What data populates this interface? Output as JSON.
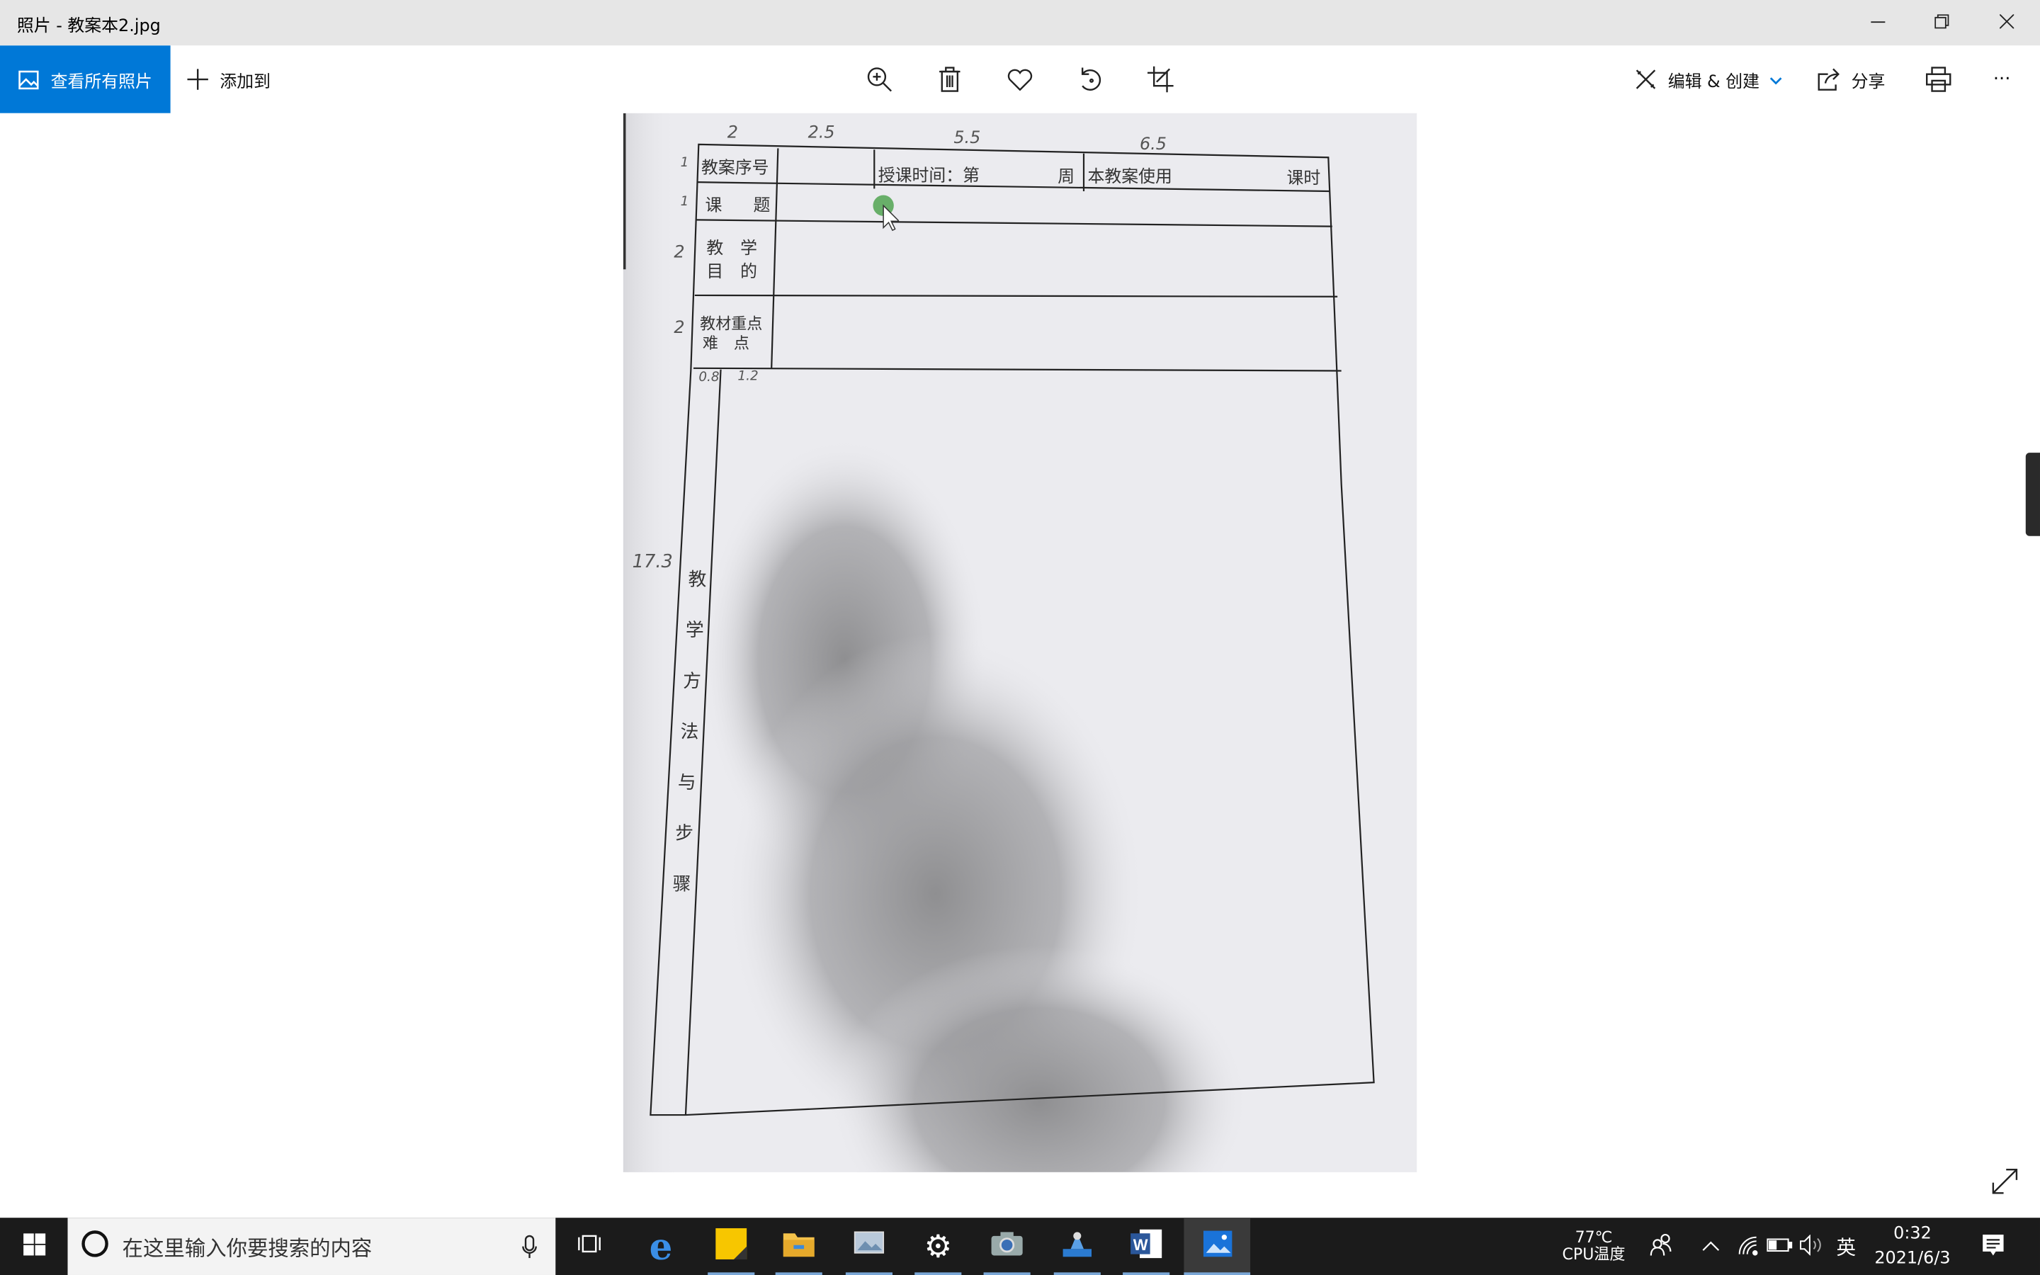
{
  "window": {
    "title": "照片 - 教案本2.jpg",
    "minimize_icon": "minimize-icon",
    "restore_icon": "restore-icon",
    "close_icon": "close-icon"
  },
  "toolbar": {
    "view_all": "查看所有照片",
    "add_to": "添加到",
    "center_icons": [
      "zoom-in-icon",
      "delete-icon",
      "heart-icon",
      "rotate-icon",
      "crop-icon"
    ],
    "edit_create": "编辑 & 创建",
    "share": "分享",
    "print_icon": "print-icon",
    "more": "···",
    "accent": "#0078d7"
  },
  "photo": {
    "file": "教案本2.jpg",
    "form": {
      "row1_label": "教案序号",
      "row1_time": "授课时间：第",
      "row1_week": "周",
      "row1_use": "本教案使用",
      "row1_hours": "课时",
      "row2_a": "课",
      "row2_b": "题",
      "row3_a": "教　学",
      "row3_b": "目　的",
      "row4_a": "教材重点",
      "row4_b": "难　点",
      "side_chars": [
        "教",
        "学",
        "方",
        "法",
        "与",
        "步",
        "骤"
      ]
    },
    "handwritten": {
      "top": [
        "2",
        "2.5",
        "5.5",
        "6.5"
      ],
      "left": [
        "1",
        "1",
        "2",
        "2"
      ],
      "side": "17.3",
      "small_a": "0.8",
      "small_b": "1.2"
    }
  },
  "taskbar": {
    "search_placeholder": "在这里输入你要搜索的内容",
    "apps": [
      "edge",
      "sticky-notes",
      "file-explorer",
      "photos-viewer",
      "settings",
      "camera",
      "app",
      "word",
      "photos"
    ],
    "cpu_temp": "77℃",
    "cpu_label": "CPU温度",
    "ime": "英",
    "time": "0:32",
    "date": "2021/6/3"
  }
}
